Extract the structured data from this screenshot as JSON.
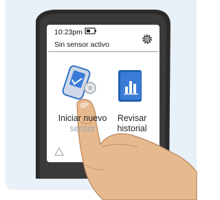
{
  "status_bar": {
    "time": "10:23pm",
    "sensor_status": "Sin sensor activo",
    "battery_icon": "battery-icon",
    "settings_icon": "gear-icon"
  },
  "menu": {
    "start_sensor": {
      "line1": "Iniciar nuevo",
      "line2": "sensor",
      "icon": "reader-sensor-icon"
    },
    "review_history": {
      "line1": "Revisar",
      "line2": "historial",
      "icon": "history-book-icon"
    }
  },
  "colors": {
    "panel_background": "#e8f0f8",
    "device_body": "#2b2b2b",
    "accent_blue": "#2f6fc4",
    "finger_skin": "#e7b98e"
  }
}
